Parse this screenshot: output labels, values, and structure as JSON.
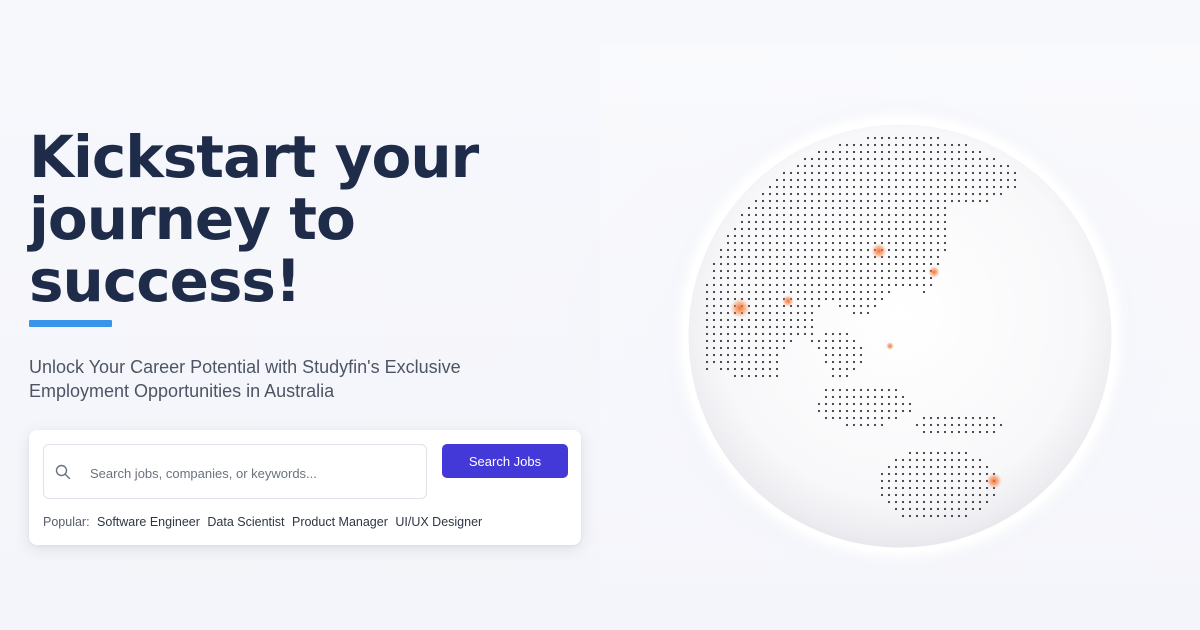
{
  "hero": {
    "headline": "Kickstart your journey to success!",
    "subtitle": "Unlock Your Career Potential with Studyfin's Exclusive Employment Opportunities in Australia"
  },
  "search": {
    "placeholder": "Search jobs, companies, or keywords...",
    "button_label": "Search Jobs",
    "popular_label": "Popular:",
    "popular_tags": [
      "Software Engineer",
      "Data Scientist",
      "Product Manager",
      "UI/UX Designer"
    ]
  },
  "colors": {
    "heading": "#1e2c4a",
    "accent_underline": "#3a95ea",
    "button": "#4339d9",
    "globe_marker": "#f26b2a"
  },
  "icons": {
    "search": "search-icon"
  }
}
